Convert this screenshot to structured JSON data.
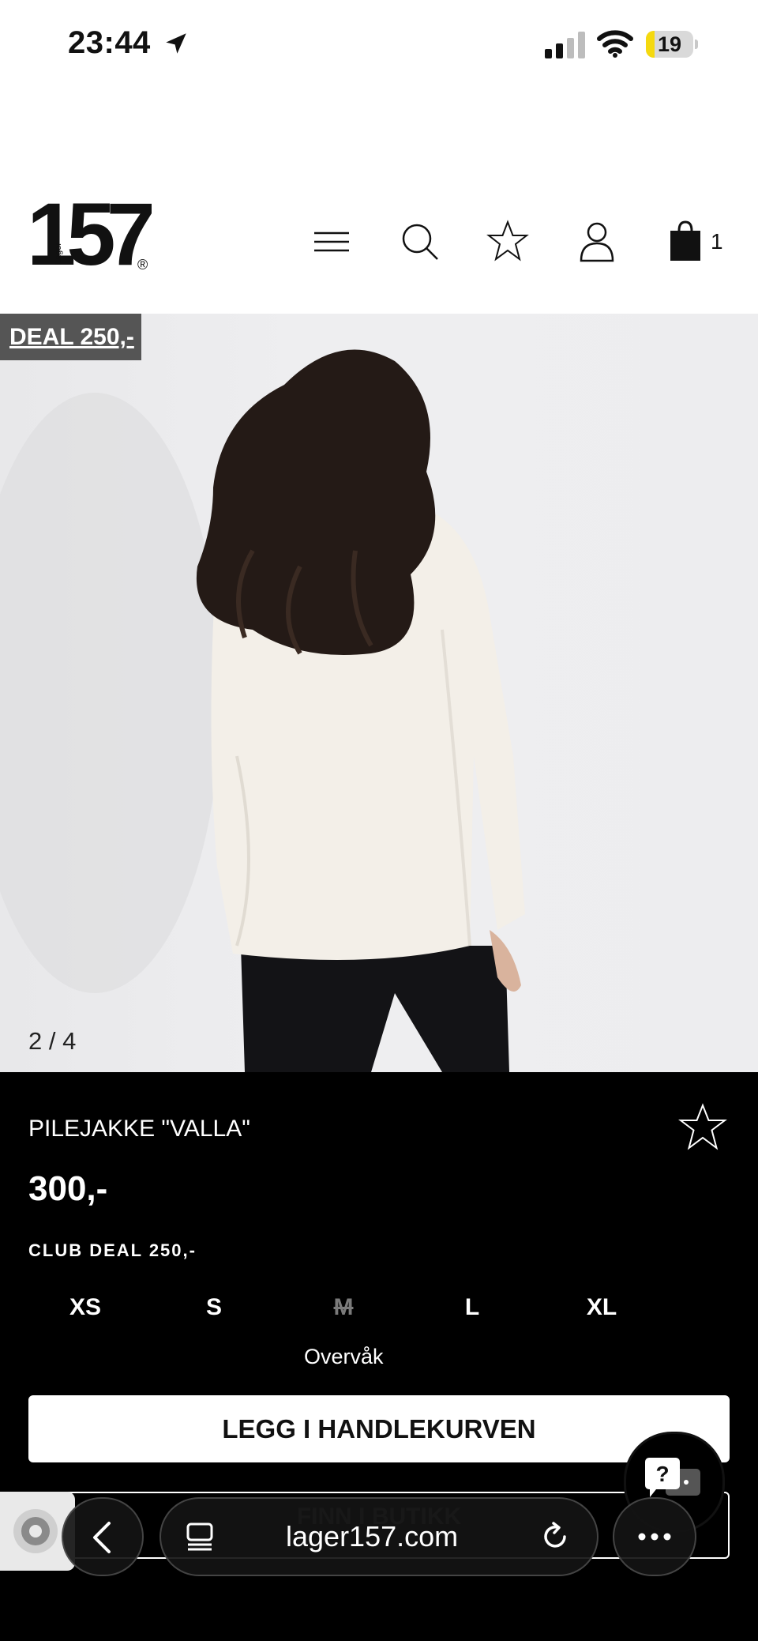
{
  "status_bar": {
    "time": "23:44",
    "battery_level": "19",
    "battery_fraction": 0.19
  },
  "header": {
    "logo_number": "157",
    "logo_small": "Lager",
    "logo_mark": "®",
    "cart_count": "1",
    "icons": [
      "menu-icon",
      "search-icon",
      "star-icon",
      "user-icon",
      "bag-icon"
    ]
  },
  "hero": {
    "badge": "DEAL 250,-",
    "counter": "2 / 4"
  },
  "product": {
    "title": "PILEJAKKE \"VALLA\"",
    "price": "300,-",
    "club_deal": "CLUB DEAL 250,-",
    "sizes": [
      {
        "label": "XS",
        "available": true
      },
      {
        "label": "S",
        "available": true
      },
      {
        "label": "M",
        "available": false
      },
      {
        "label": "L",
        "available": true
      },
      {
        "label": "XL",
        "available": true
      }
    ],
    "watch_label": "Overvåk",
    "add_to_cart": "LEGG I HANDLEKURVEN",
    "find_in_store": "FINN I BUTIKK",
    "help_symbol": "?"
  },
  "browser": {
    "url": "lager157.com"
  },
  "colors": {
    "panel_bg": "#000000",
    "badge_bg": "#555555",
    "battery_fill": "#f5d90f"
  }
}
